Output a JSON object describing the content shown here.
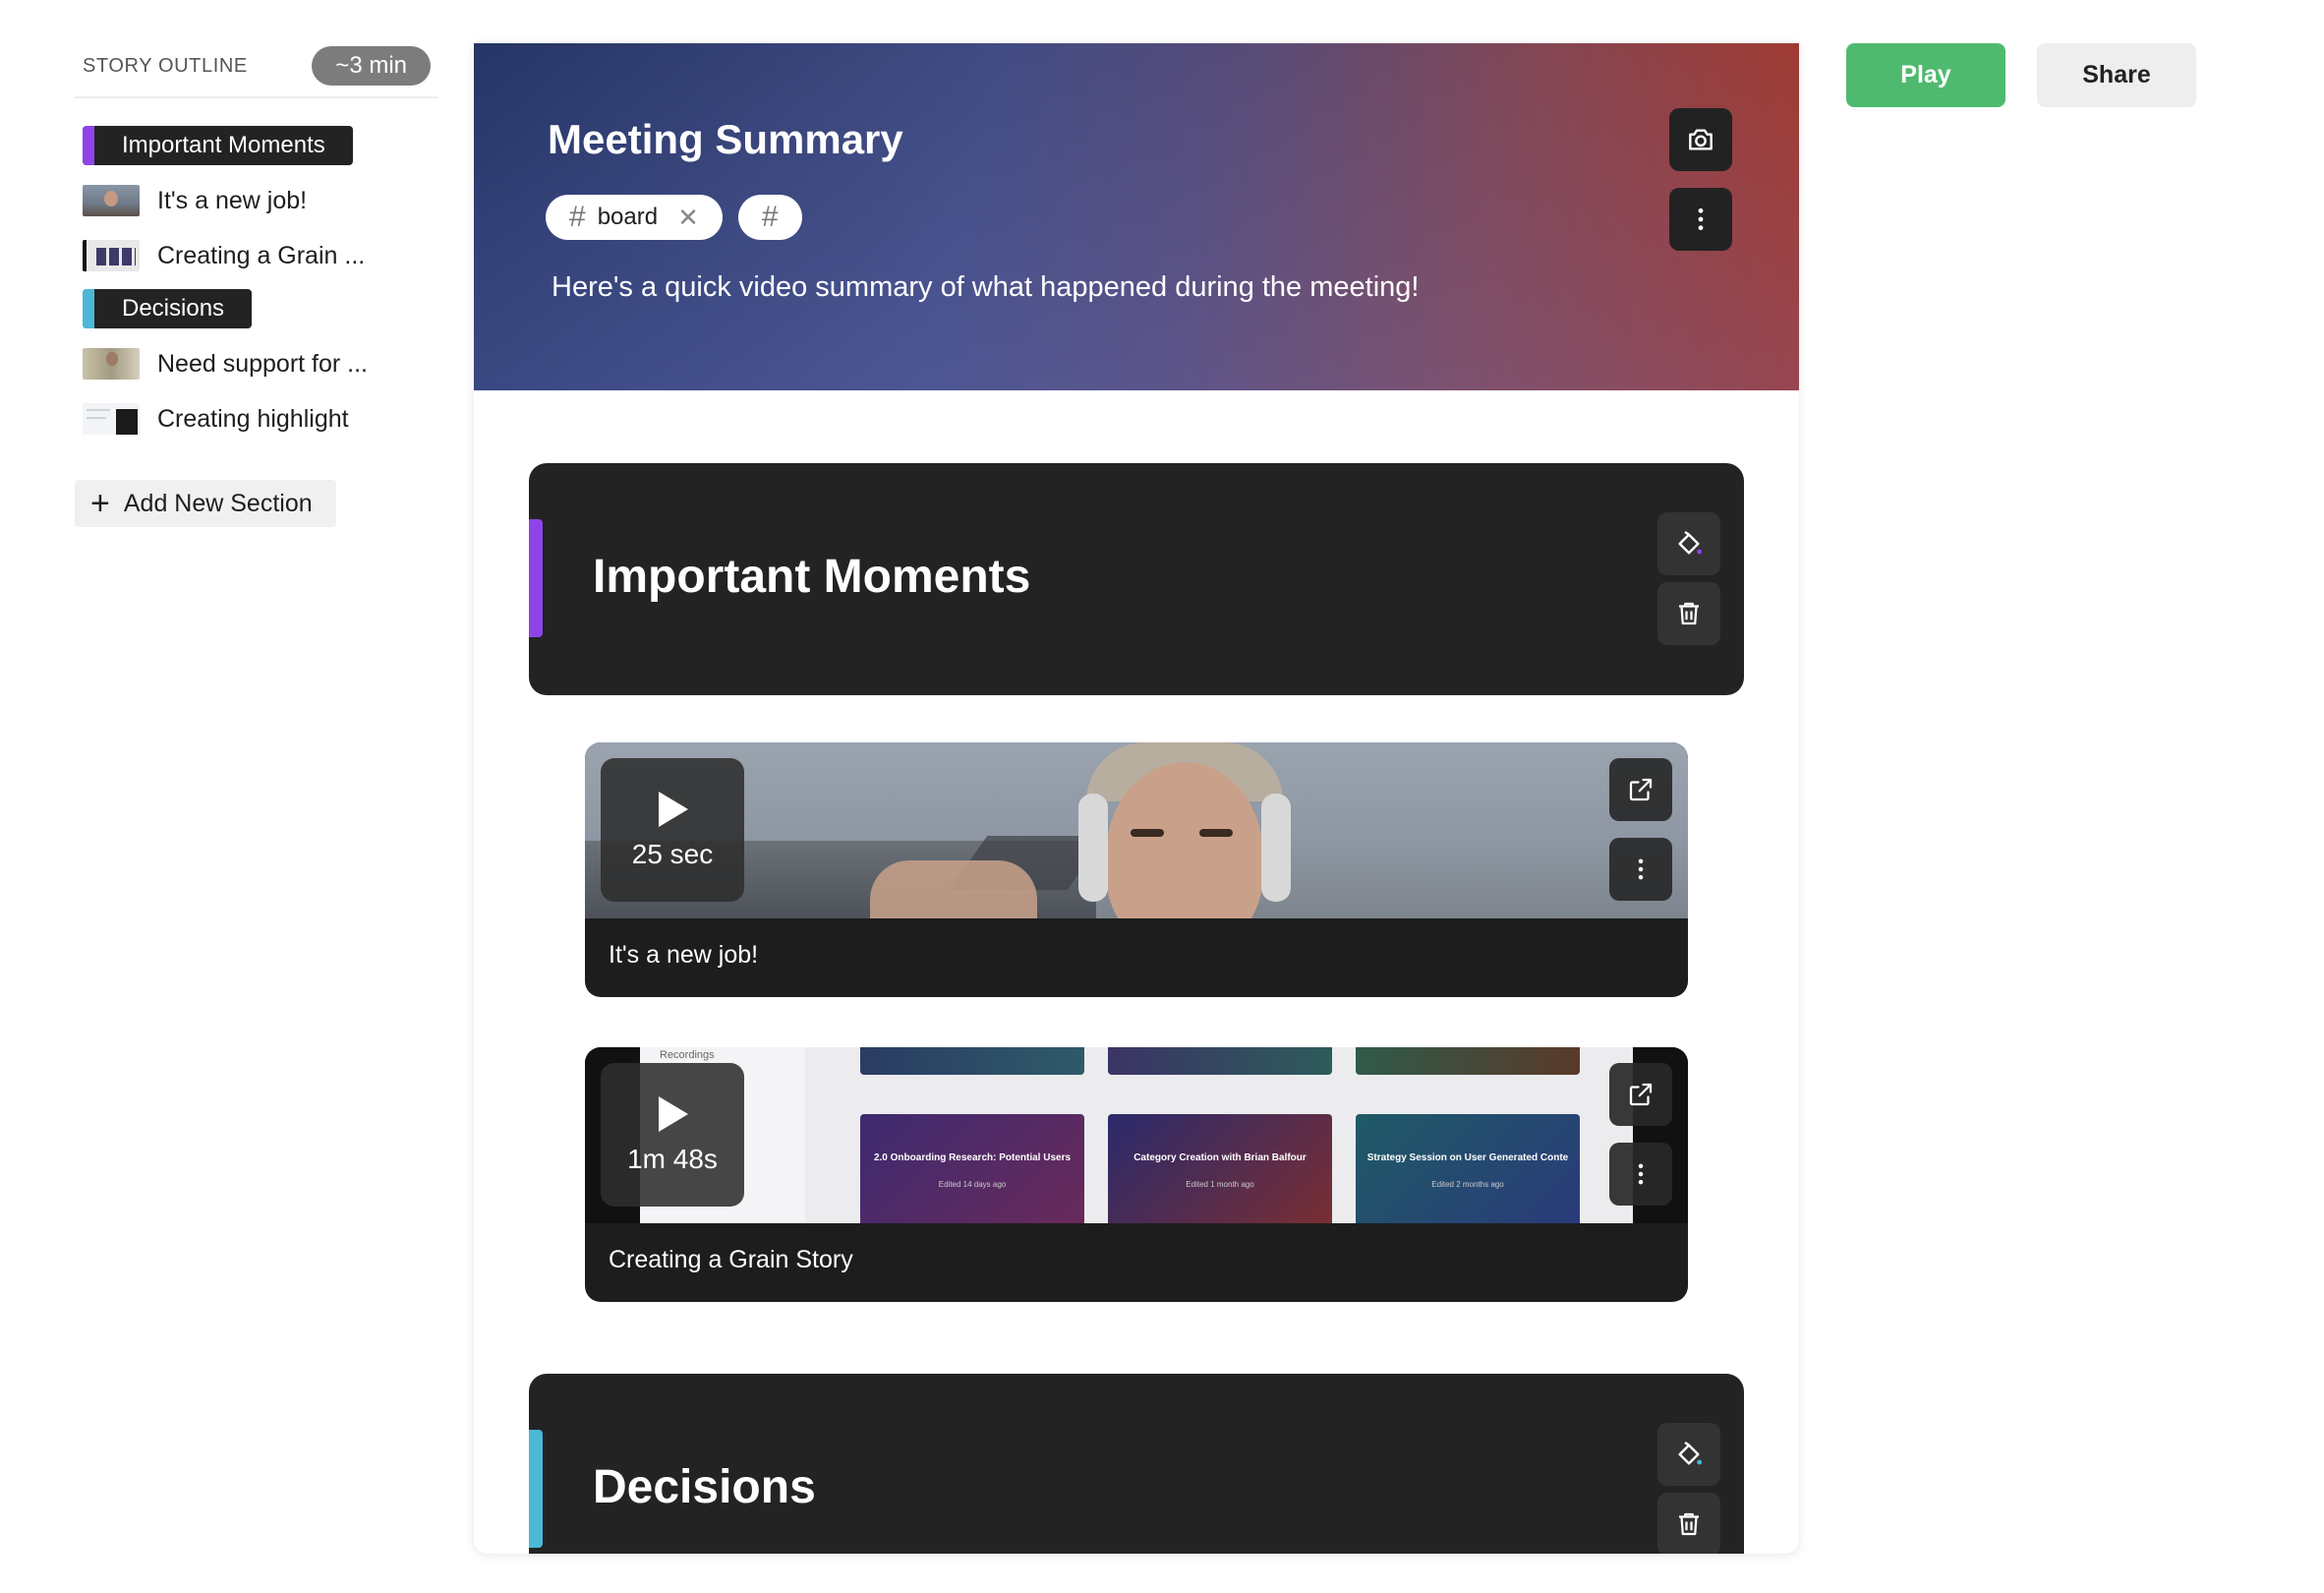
{
  "sidebar": {
    "title": "STORY OUTLINE",
    "duration": "~3 min",
    "items": [
      {
        "type": "section",
        "label": "Important Moments",
        "color": "#8e44e8"
      },
      {
        "type": "clip",
        "label": "It's a new job!"
      },
      {
        "type": "clip",
        "label": "Creating a Grain ..."
      },
      {
        "type": "section",
        "label": "Decisions",
        "color": "#4bb8d8"
      },
      {
        "type": "clip",
        "label": "Need support for ..."
      },
      {
        "type": "clip",
        "label": "Creating highlight"
      }
    ],
    "add_section_label": "Add New Section"
  },
  "toolbar": {
    "play_label": "Play",
    "share_label": "Share"
  },
  "story": {
    "title": "Meeting Summary",
    "tags": [
      {
        "label": "board"
      },
      {
        "label": ""
      }
    ],
    "description": "Here's a quick video summary of what happened during the meeting!"
  },
  "sections": [
    {
      "title": "Important Moments",
      "accent": "#8e44e8",
      "clips": [
        {
          "label": "It's a new job!",
          "duration": "25 sec"
        },
        {
          "label": "Creating a Grain Story",
          "duration": "1m 48s"
        }
      ]
    },
    {
      "title": "Decisions",
      "accent": "#4bb8d8",
      "clips": []
    }
  ],
  "recordings_preview": {
    "header": "Recordings",
    "cards": [
      {
        "title": "2.0 Onboarding Research: Potential Users",
        "meta": "Edited 14 days ago"
      },
      {
        "title": "Category Creation with Brian Balfour",
        "meta": "Edited 1 month ago"
      },
      {
        "title": "Strategy Session on User Generated Conte",
        "meta": "Edited 2 months ago"
      }
    ]
  },
  "icons": {
    "camera": "camera-icon",
    "more": "more-vertical-icon",
    "paint": "paint-bucket-icon",
    "trash": "trash-icon",
    "open": "external-link-icon",
    "play": "play-icon",
    "plus": "plus-icon",
    "hash": "hash-icon",
    "close": "close-icon"
  }
}
